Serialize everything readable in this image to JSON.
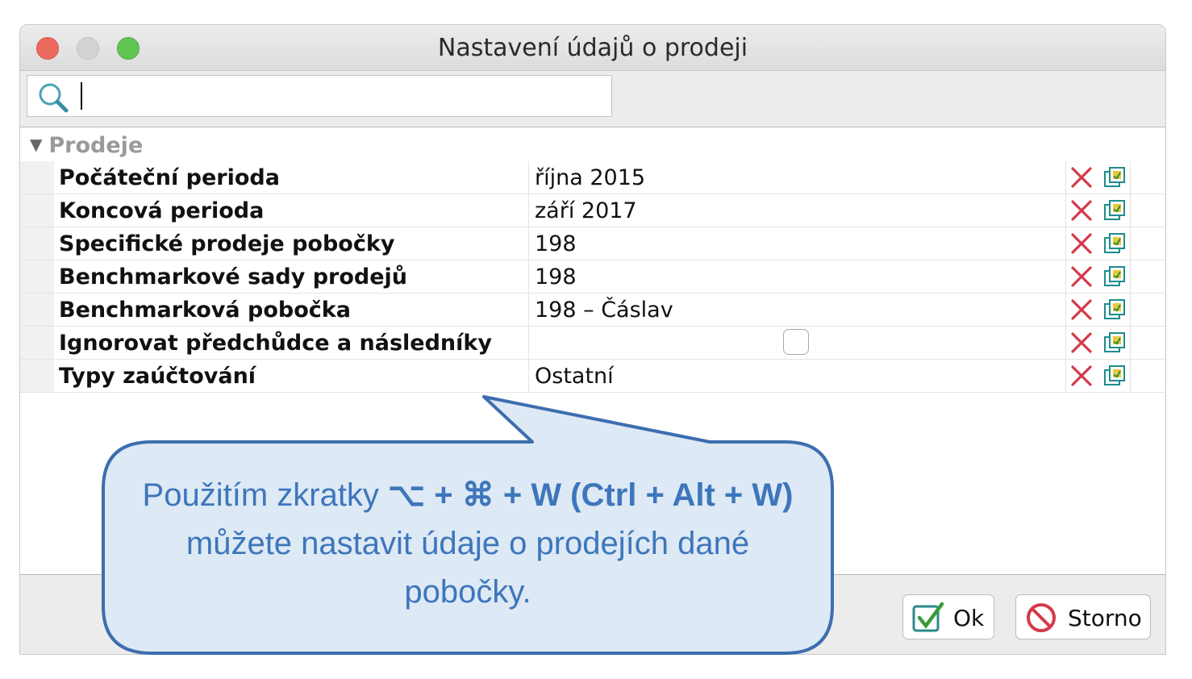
{
  "window": {
    "title": "Nastavení údajů o prodeji"
  },
  "search": {
    "value": "",
    "placeholder": ""
  },
  "group": {
    "label": "Prodeje"
  },
  "rows": [
    {
      "label": "Počáteční perioda",
      "value": "října 2015"
    },
    {
      "label": "Koncová perioda",
      "value": "září 2017"
    },
    {
      "label": "Specifické prodeje pobočky",
      "value": "198"
    },
    {
      "label": "Benchmarkové sady prodejů",
      "value": "198"
    },
    {
      "label": "Benchmarková pobočka",
      "value": "198 – Čáslav"
    },
    {
      "label": "Ignorovat předchůdce a následníky",
      "value": "",
      "checked": false
    },
    {
      "label": "Typy zaúčtování",
      "value": "Ostatní"
    }
  ],
  "buttons": {
    "ok": "Ok",
    "cancel": "Storno"
  },
  "callout": {
    "part1": "Použitím zkratky ",
    "shortcut": "⌥ + ⌘ + W (Ctrl + Alt + W)",
    "part2": " můžete nastavit údaje o prodejích dané pobočky."
  },
  "colors": {
    "callout_text": "#3d76bc",
    "callout_border": "#3d6eb0",
    "callout_fill": "#dde9f4",
    "delete_icon": "#d43a4a"
  }
}
